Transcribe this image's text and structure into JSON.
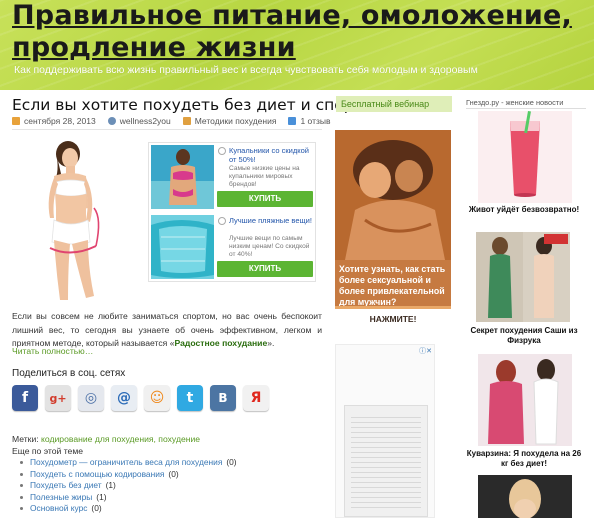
{
  "header": {
    "title": "Правильное питание, омоложение, продление жизни",
    "description": "Как поддерживать всю жизнь правильный вес и всегда чувствовать себя молодым и здоровым"
  },
  "post": {
    "title": "Если вы хотите похудеть без диет и спорта",
    "date": "сентября 28, 2013",
    "author": "wellness2you",
    "category": "Методики похудения",
    "comments": "1 отзыв",
    "excerpt_before": "Если вы совсем не любите заниматься спортом, но вас очень беспокоит лишний вес, то сегодня вы узнаете об очень эффективном, легком и приятном методе, который называется «",
    "excerpt_link": "Радостное похудание",
    "excerpt_after": "».",
    "read_more": "Читать полностью…"
  },
  "ad_unit": {
    "items": [
      {
        "title": "Купальники со скидкой от 50%!",
        "text": "Самые низкие цены на купальники мировых брендов!",
        "button": "КУПИТЬ"
      },
      {
        "title": "Лучшие пляжные вещи!",
        "text": "Лучшие вещи по самым низким ценам! Со скидкой от 40%!",
        "button": "КУПИТЬ"
      }
    ]
  },
  "share": {
    "title": "Поделиться в соц. сетях",
    "buttons": [
      {
        "name": "facebook",
        "glyph": "f",
        "color": "#3b5a9a"
      },
      {
        "name": "google-plus",
        "glyph": "g+",
        "color": "#d8d8d8"
      },
      {
        "name": "myspace",
        "glyph": "◎",
        "color": "#e5e8ee"
      },
      {
        "name": "mail",
        "glyph": "@",
        "color": "#e8edf3"
      },
      {
        "name": "odnoklassniki",
        "glyph": "☺",
        "color": "#f0f0f0"
      },
      {
        "name": "twitter",
        "glyph": "t",
        "color": "#30a9e2"
      },
      {
        "name": "vkontakte",
        "glyph": "B",
        "color": "#4c75a3"
      },
      {
        "name": "yandex",
        "glyph": "Я",
        "color": "#f1f1f1"
      }
    ]
  },
  "tags": {
    "label": "Метки:",
    "links": "кодирование для похудения, похудение",
    "more_label": "Еще по этой теме"
  },
  "related": [
    {
      "title": "Похудометр — ограничитель веса для похудения",
      "count": "(0)"
    },
    {
      "title": "Похудеть с помощью кодирования",
      "count": "(0)"
    },
    {
      "title": "Похудеть без диет",
      "count": "(1)"
    },
    {
      "title": "Полезные жиры",
      "count": "(1)"
    },
    {
      "title": "Основной курс",
      "count": "(0)"
    }
  ],
  "middle": {
    "title": "Бесплатный вебинар",
    "ad_text": "Хотите узнать, как стать более сексуальной и более привлекательной для мужчин?",
    "ad_button": "НАЖМИТЕ!"
  },
  "right": {
    "title": "Гнездо.ру - женские новости",
    "news": [
      {
        "caption": "Живот уйдёт безвозвратно!"
      },
      {
        "caption": "Секрет похудения Саши из Физрука"
      },
      {
        "caption": "Куварзина: Я похудела на 26 кг без диет!"
      }
    ]
  }
}
